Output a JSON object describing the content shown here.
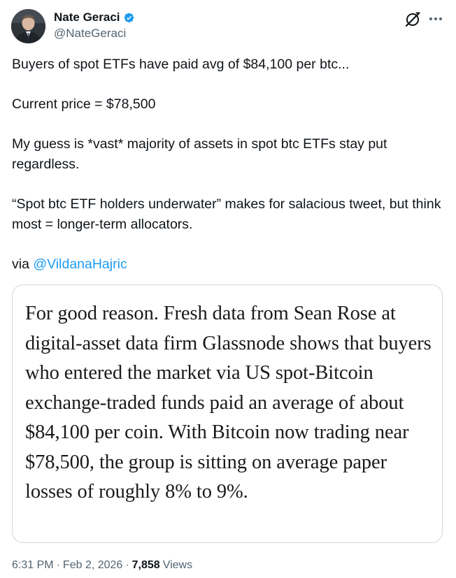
{
  "author": {
    "display_name": "Nate Geraci",
    "handle": "@NateGeraci",
    "verified": true
  },
  "tweet": {
    "paragraphs": [
      "Buyers of spot ETFs have paid avg of $84,100 per btc...",
      "Current price = $78,500",
      "My guess is *vast* majority of assets in spot btc ETFs stay put regardless.",
      "“Spot btc ETF holders underwater” makes for salacious tweet, but think most = longer-term allocators."
    ],
    "via_prefix": "via ",
    "via_mention": "@VildanaHajric"
  },
  "quoted_image": {
    "text": "For good reason. Fresh data from Sean Rose at digital-asset data firm Glassnode shows that buyers who entered the market via US spot-Bitcoin exchange-traded funds paid an average of about $84,100 per coin. With Bitcoin now trading near $78,500, the group is sitting on average paper losses of roughly 8% to 9%."
  },
  "meta": {
    "time": "6:31 PM",
    "date": "Feb 2, 2026",
    "views_count": "7,858",
    "views_label": "Views",
    "separator": "·"
  },
  "icons": {
    "grok": "grok-icon",
    "more": "more-icon",
    "verified": "verified-badge-icon"
  },
  "colors": {
    "link": "#1d9bf0",
    "secondary": "#536471",
    "primary": "#0f1419",
    "border": "#cfd9de",
    "verified": "#1d9bf0"
  }
}
